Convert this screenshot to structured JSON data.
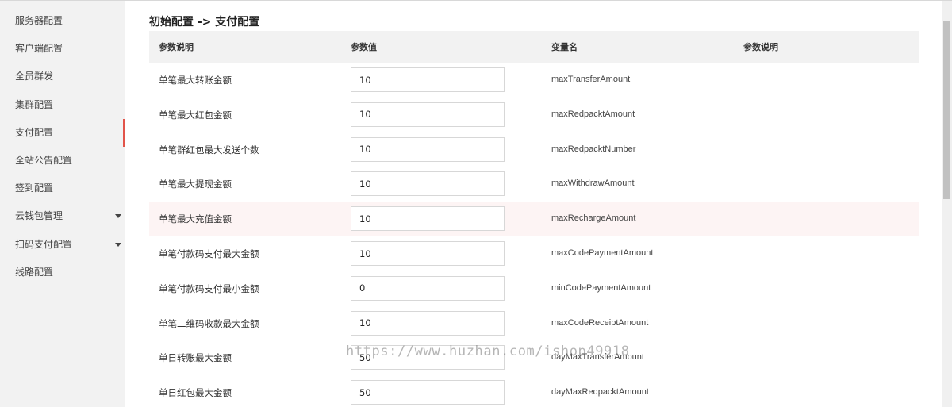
{
  "sidebar": {
    "items": [
      {
        "label": "服务器配置"
      },
      {
        "label": "客户端配置"
      },
      {
        "label": "全员群发"
      },
      {
        "label": "集群配置"
      },
      {
        "label": "支付配置"
      },
      {
        "label": "全站公告配置"
      },
      {
        "label": "签到配置"
      },
      {
        "label": "云钱包管理"
      },
      {
        "label": "扫码支付配置"
      },
      {
        "label": "线路配置"
      }
    ],
    "active_index": 4,
    "accent_color": "#e2544a"
  },
  "page": {
    "title": "初始配置 -> 支付配置"
  },
  "table": {
    "headers": [
      "参数说明",
      "参数值",
      "变量名",
      "参数说明"
    ],
    "rows": [
      {
        "label": "单笔最大转账金额",
        "value": "10",
        "var": "maxTransferAmount"
      },
      {
        "label": "单笔最大红包金额",
        "value": "10",
        "var": "maxRedpacktAmount"
      },
      {
        "label": "单笔群红包最大发送个数",
        "value": "10",
        "var": "maxRedpacktNumber"
      },
      {
        "label": "单笔最大提现金额",
        "value": "10",
        "var": "maxWithdrawAmount"
      },
      {
        "label": "单笔最大充值金额",
        "value": "10",
        "var": "maxRechargeAmount"
      },
      {
        "label": "单笔付款码支付最大金额",
        "value": "10",
        "var": "maxCodePaymentAmount"
      },
      {
        "label": "单笔付款码支付最小金额",
        "value": "0",
        "var": "minCodePaymentAmount"
      },
      {
        "label": "单笔二维码收款最大金额",
        "value": "10",
        "var": "maxCodeReceiptAmount"
      },
      {
        "label": "单日转账最大金额",
        "value": "50",
        "var": "dayMaxTransferAmount"
      },
      {
        "label": "单日红包最大金额",
        "value": "50",
        "var": "dayMaxRedpacktAmount"
      }
    ],
    "highlighted_row_index": 4
  },
  "watermark": {
    "text": "https://www.huzhan.com/ishop49918"
  }
}
